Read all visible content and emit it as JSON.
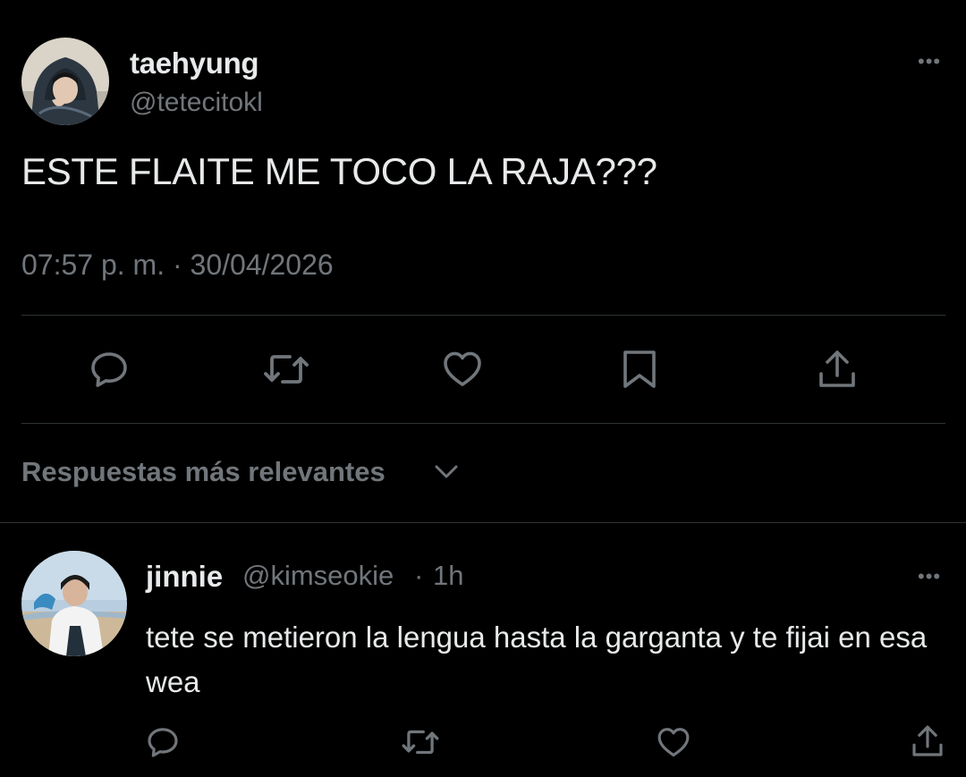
{
  "tweet": {
    "author_name": "taehyung",
    "author_handle": "@tetecitokl",
    "text": "ESTE FLAITE ME TOCO LA RAJA???",
    "timestamp": "07:57 p. m. · 30/04/2026",
    "more_label": "•••",
    "actions": [
      "reply-icon",
      "retweet-icon",
      "like-icon",
      "bookmark-icon",
      "share-icon"
    ]
  },
  "replies_sort": {
    "label": "Respuestas más relevantes",
    "icon": "chevron-down-icon"
  },
  "reply": {
    "author_name": "jinnie",
    "author_handle": "@kimseokie",
    "separator": "·",
    "time": "1h",
    "text": "tete se metieron la lengua hasta la garganta y te fijai en esa wea",
    "more_label": "•••",
    "actions": [
      "reply-icon",
      "retweet-icon",
      "like-icon",
      "share-icon"
    ]
  },
  "colors": {
    "background": "#000000",
    "primary_text": "#e7e9ea",
    "secondary_text": "#71767b",
    "divider": "#2f3336"
  }
}
